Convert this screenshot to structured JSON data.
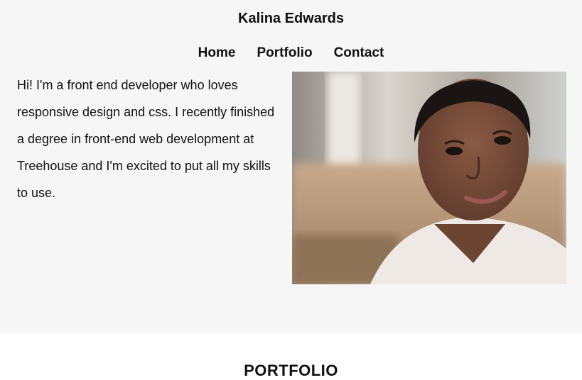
{
  "header": {
    "title": "Kalina Edwards",
    "nav": [
      "Home",
      "Portfolio",
      "Contact"
    ]
  },
  "intro": {
    "text": "Hi! I'm a front end developer who loves responsive design and css. I recently finished a degree in front-end web development at Treehouse and I'm excited to put all my skills to use."
  },
  "portfolio": {
    "heading": "PORTFOLIO"
  },
  "colors": {
    "hero_background": "#f6f6f6",
    "page_background": "#ffffff",
    "text": "#111111"
  }
}
